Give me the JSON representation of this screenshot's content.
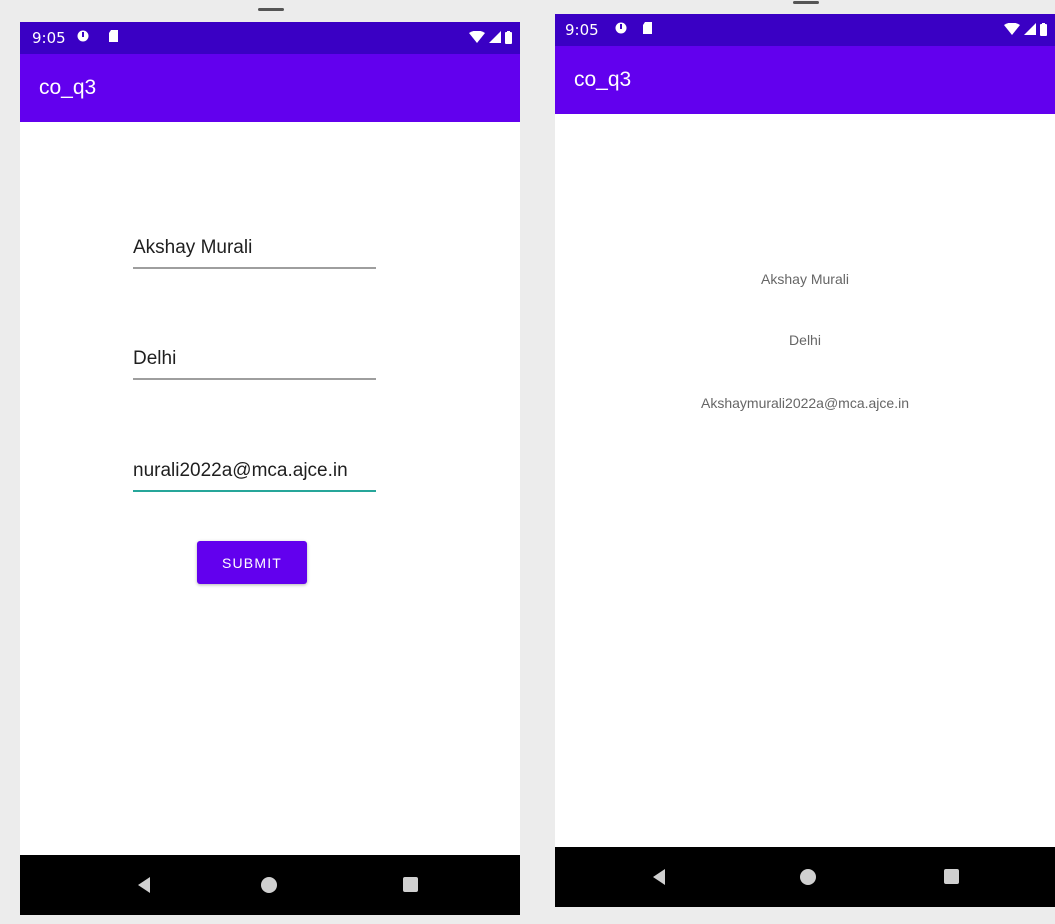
{
  "status_bar": {
    "time": "9:05",
    "icons": [
      "data-saver-icon",
      "sd-card-icon"
    ],
    "right_icons": [
      "wifi-icon",
      "signal-icon",
      "battery-icon"
    ]
  },
  "form_screen": {
    "app_title": "co_q3",
    "name_value": "Akshay Murali",
    "city_value": "Delhi",
    "email_value": "nurali2022a@mca.ajce.in",
    "submit_label": "SUBMIT"
  },
  "result_screen": {
    "app_title": "co_q3",
    "name_text": "Akshay Murali",
    "city_text": "Delhi",
    "email_text": "Akshaymurali2022a@mca.ajce.in"
  },
  "nav": [
    "back-icon",
    "home-icon",
    "recents-icon"
  ],
  "colors": {
    "status_bar": "#3a00c4",
    "app_bar": "#6200ee",
    "accent": "#26a69a"
  }
}
